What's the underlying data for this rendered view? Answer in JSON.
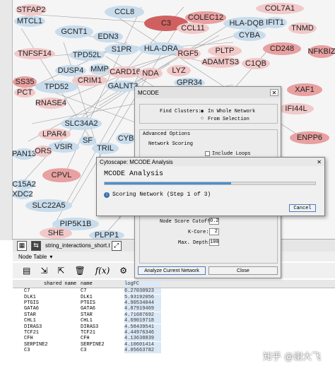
{
  "network_nodes": {
    "stfap2": "STFAP2",
    "ccl8": "CCL8",
    "col7a1": "COL7A1",
    "mtcl1": "MTCL1",
    "gcnt1": "GCNT1",
    "edn3": "EDN3",
    "c3": "C3",
    "colec12": "COLEC12",
    "hla_dqb1": "HLA-DQB1",
    "ifit1": "IFIT1",
    "tnmd": "TNMD",
    "ccl11": "CCL11",
    "cyba": "CYBA",
    "tnfsf14": "TNFSF14",
    "tpd52l": "TPD52L",
    "s1pr": "S1PR",
    "hla_dra": "HLA-DRA",
    "rgf5": "RGF5",
    "pltp": "PLTP",
    "cd248": "CD248",
    "nfkbiz": "NFKBIZ",
    "dusp4": "DUSP4",
    "mmp": "MMP",
    "adamts3": "ADAMTS3",
    "c1qb": "C1QB",
    "card16": "CARD16",
    "nda": "NDA",
    "lyz": "LYZ",
    "gpr34": "GPR34",
    "ss35": "SS35",
    "crim1": "CRIM1",
    "tpd52": "TPD52",
    "galnt3": "GALNT3",
    "xaf1": "XAF1",
    "pct": "PCT",
    "rnase4": "RNASE4",
    "ifi44l": "IFI44L",
    "slc34a2": "SLC34A2",
    "lpar4": "LPAR4",
    "vsir": "VSIR",
    "cyb": "CYB",
    "enpp6": "ENPP6",
    "pan13": "PAN13",
    "ors": "ORS",
    "tril": "TRIL",
    "sf": "SF",
    "cpvl": "CPVL",
    "c15a2": "C15A2",
    "xdc2": "XDC2",
    "slc22a5": "SLC22A5",
    "pip5k1b": "PIP5K1B",
    "she": "SHE",
    "plpp1": "PLPP1"
  },
  "toolbar": {
    "network_file": "string_interactions_short.t"
  },
  "table_panel": {
    "tab_label": "Node Table",
    "headers": {
      "shared_name": "shared name",
      "name": "name",
      "logfc": "logFC"
    },
    "rows": [
      {
        "shared": "C7",
        "name": "C7",
        "logfc": "6.27030923"
      },
      {
        "shared": "DLK1",
        "name": "DLK1",
        "logfc": "5.93192056"
      },
      {
        "shared": "PTGIS",
        "name": "PTGIS",
        "logfc": "4.90534044"
      },
      {
        "shared": "GATA6",
        "name": "GATA6",
        "logfc": "4.87919469"
      },
      {
        "shared": "STAR",
        "name": "STAR",
        "logfc": "4.71687692"
      },
      {
        "shared": "CHL1",
        "name": "CHL1",
        "logfc": "4.69019718"
      },
      {
        "shared": "DIRAS3",
        "name": "DIRAS3",
        "logfc": "4.58439541"
      },
      {
        "shared": "TCF21",
        "name": "TCF21",
        "logfc": "4.44976346"
      },
      {
        "shared": "CFH",
        "name": "CFH",
        "logfc": "4.13638839"
      },
      {
        "shared": "SERPINE2",
        "name": "SERPINE2",
        "logfc": "4.10601414"
      },
      {
        "shared": "C3",
        "name": "C3",
        "logfc": "4.05663782"
      }
    ]
  },
  "mcode_dialog": {
    "title": "MCODE",
    "find_clusters_label": "Find Clusters:",
    "option_whole": "In Whole Network",
    "option_selection": "From Selection",
    "advanced_label": "Advanced Options",
    "network_scoring_label": "Network Scoring",
    "include_loops": "Include Loops",
    "node_score_cutoff_label": "Node Score Cutoff:",
    "node_score_cutoff": "0.2",
    "kcore_label": "K-Core:",
    "kcore": "2",
    "max_depth_label": "Max. Depth:",
    "max_depth": "100",
    "analyze_button": "Analyze Current Network",
    "close_button": "Close"
  },
  "progress_dialog": {
    "window_title": "Cytoscape: MCODE Analysis",
    "heading": "MCODE Analysis",
    "status": "Scoring Network (Step 1 of 3)",
    "progress_fraction": 0.6,
    "cancel_button": "Cancel"
  },
  "watermark": "知乎 @谢大飞"
}
